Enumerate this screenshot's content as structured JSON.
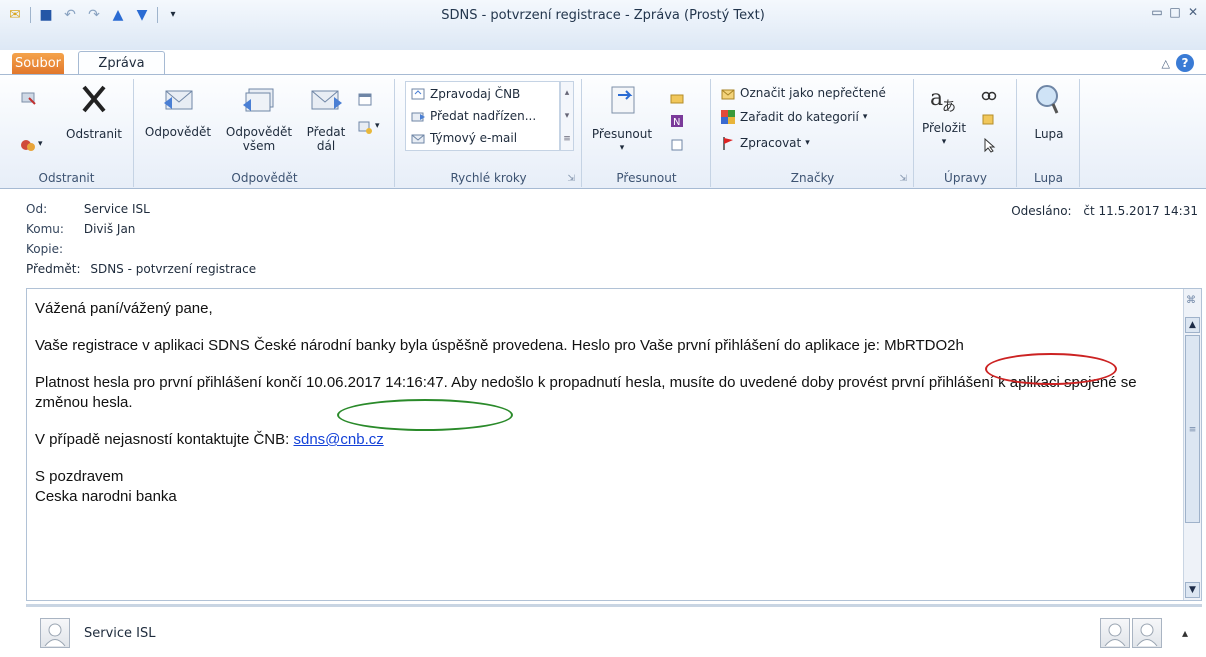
{
  "window": {
    "title": "SDNS - potvrzení registrace  -  Zpráva (Prostý Text)"
  },
  "tabs": {
    "file": "Soubor",
    "message": "Zpráva"
  },
  "ribbon": {
    "delete_group": {
      "label": "Odstranit",
      "delete_button": "Odstranit"
    },
    "respond_group": {
      "label": "Odpovědět",
      "reply": "Odpovědět",
      "reply_all_line1": "Odpovědět",
      "reply_all_line2": "všem",
      "forward_line1": "Předat",
      "forward_line2": "dál"
    },
    "quick_steps": {
      "label": "Rychlé kroky",
      "items": [
        "Zpravodaj ČNB",
        "Předat nadřízen...",
        "Týmový e-mail"
      ]
    },
    "move_group": {
      "label": "Přesunout",
      "move_button": "Přesunout"
    },
    "tags_group": {
      "label": "Značky",
      "mark_unread": "Označit jako nepřečtené",
      "categorize": "Zařadit do kategorií",
      "followup": "Zpracovat"
    },
    "editing_group": {
      "label": "Úpravy",
      "translate": "Přeložit"
    },
    "zoom_group": {
      "label": "Lupa",
      "zoom_button": "Lupa"
    }
  },
  "header": {
    "from_label": "Od:",
    "from_value": "Service ISL",
    "to_label": "Komu:",
    "to_value": "Diviš Jan",
    "cc_label": "Kopie:",
    "subject_label": "Předmět:",
    "subject_value": "SDNS - potvrzení registrace",
    "sent_label": "Odesláno:",
    "sent_value": "čt 11.5.2017 14:31"
  },
  "body": {
    "greeting": "Vážená paní/vážený pane,",
    "para1": "Vaše registrace v aplikaci SDNS České národní banky byla úspěšně provedena. Heslo pro Vaše první přihlášení do aplikace je: MbRTDO2h",
    "para2": "Platnost hesla pro první přihlášení končí 10.06.2017 14:16:47. Aby nedošlo k propadnutí hesla, musíte do uvedené doby provést první přihlášení k aplikaci spojené se změnou hesla.",
    "contact_prefix": "V případě nejasností kontaktujte ČNB: ",
    "contact_email": "sdns@cnb.cz",
    "closing": "S pozdravem",
    "signature": "Ceska narodni banka"
  },
  "people_pane": {
    "name": "Service ISL"
  },
  "colors": {
    "password_highlight": "#cc2222",
    "date_highlight": "#2a8a2a",
    "file_tab": "#e58a34"
  }
}
